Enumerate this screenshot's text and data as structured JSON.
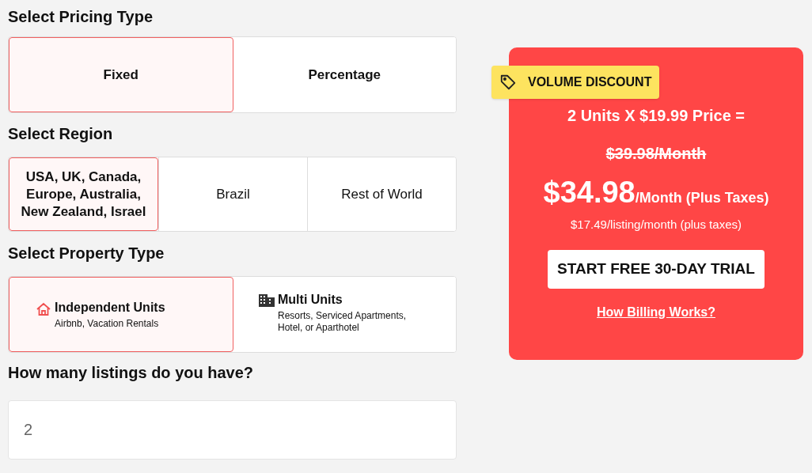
{
  "pricing_type": {
    "heading": "Select Pricing Type",
    "options": [
      {
        "label": "Fixed",
        "selected": true
      },
      {
        "label": "Percentage",
        "selected": false
      }
    ]
  },
  "region": {
    "heading": "Select Region",
    "options": [
      {
        "label": "USA, UK, Canada, Europe, Australia, New Zealand, Israel",
        "selected": true
      },
      {
        "label": "Brazil",
        "selected": false
      },
      {
        "label": "Rest of World",
        "selected": false
      }
    ]
  },
  "property_type": {
    "heading": "Select Property Type",
    "options": [
      {
        "kind": "house",
        "title": "Independent Units",
        "subtitle": "Airbnb, Vacation Rentals",
        "selected": true
      },
      {
        "kind": "building",
        "title": "Multi Units",
        "subtitle": "Resorts, Serviced Apartments, Hotel, or Aparthotel",
        "selected": false
      }
    ]
  },
  "listings": {
    "heading": "How many listings do you have?",
    "value": "2"
  },
  "price_card": {
    "badge": "VOLUME DISCOUNT",
    "calculation": "2 Units X $19.99 Price =",
    "old_price": "$39.98/Month",
    "price": "$34.98",
    "price_suffix": "/Month (Plus Taxes)",
    "per_listing": "$17.49/listing/month (plus taxes)",
    "cta": "START FREE 30-DAY TRIAL",
    "link": "How Billing Works?"
  }
}
